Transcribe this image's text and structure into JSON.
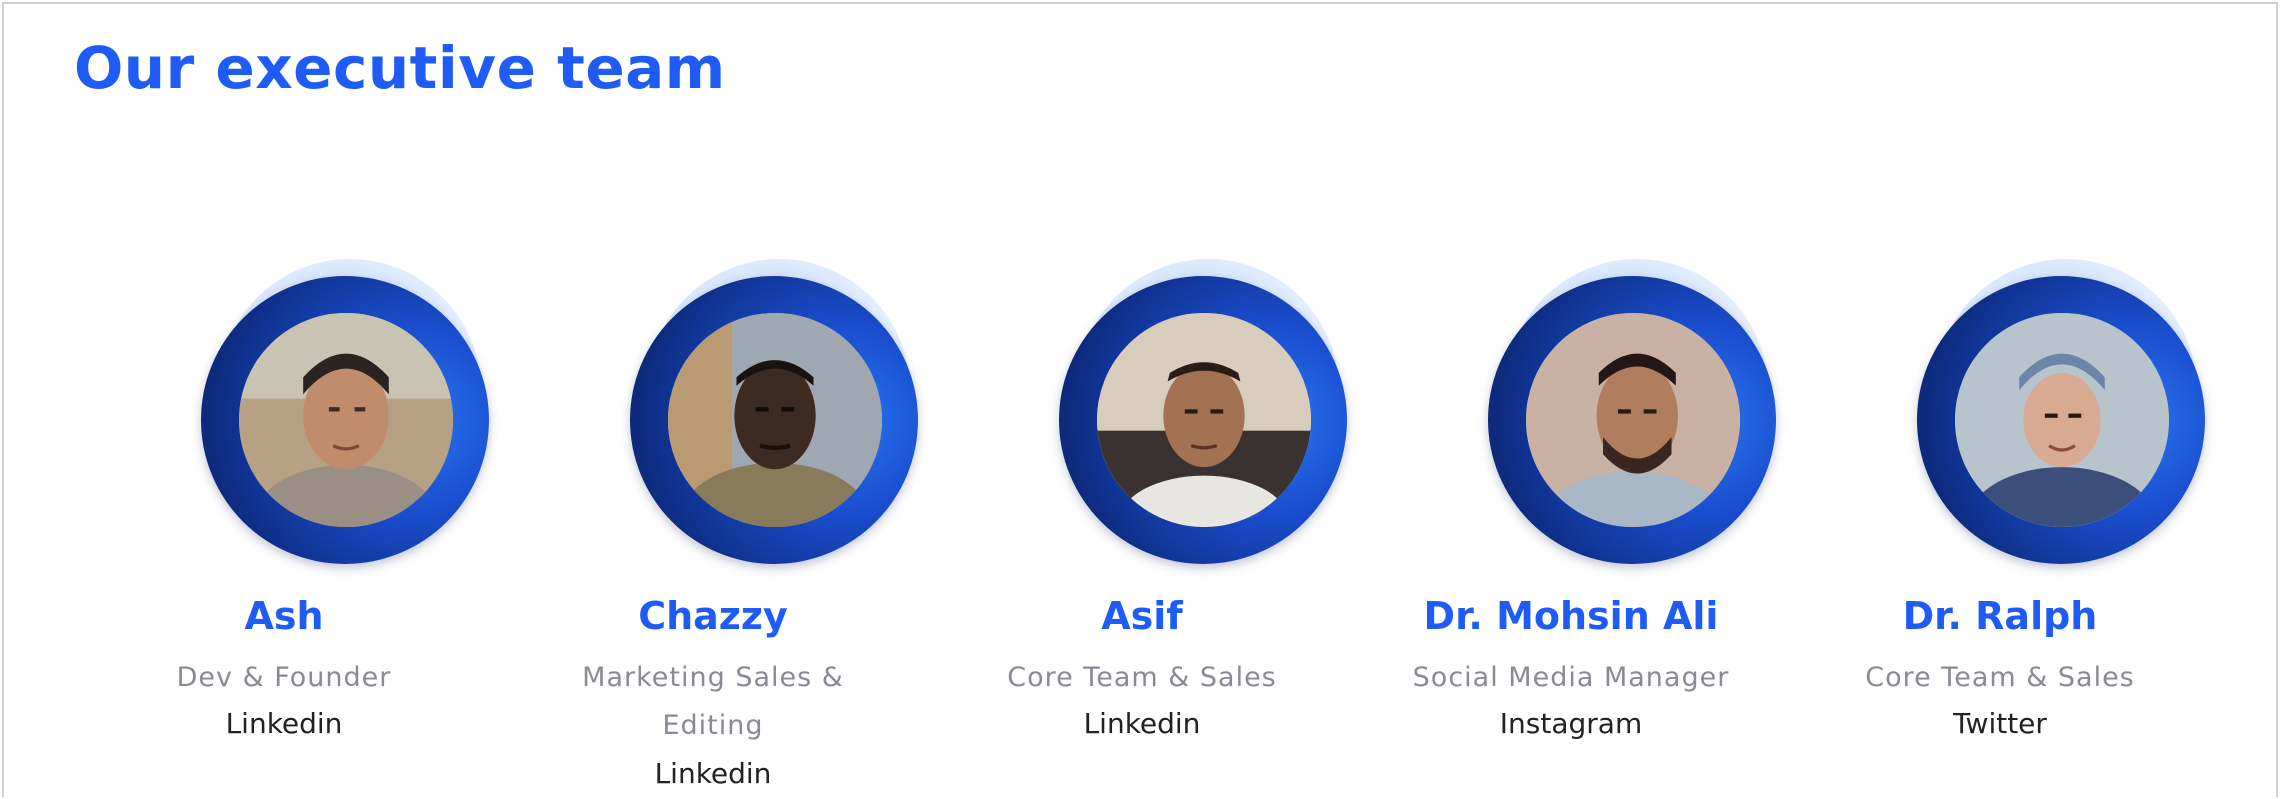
{
  "section": {
    "title": "Our executive team"
  },
  "members": [
    {
      "name": "Ash",
      "role": "Dev & Founder",
      "social": "Linkedin"
    },
    {
      "name": "Chazzy",
      "role": "Marketing Sales & Editing",
      "social": "Linkedin"
    },
    {
      "name": "Asif",
      "role": "Core Team & Sales",
      "social": "Linkedin"
    },
    {
      "name": "Dr. Mohsin Ali",
      "role": "Social Media Manager",
      "social": "Instagram"
    },
    {
      "name": "Dr. Ralph",
      "role": "Core Team & Sales",
      "social": "Twitter"
    }
  ],
  "colors": {
    "accent": "#1f5cf5",
    "ring_dark": "#0e2e86",
    "role_text": "#8a8a94"
  }
}
